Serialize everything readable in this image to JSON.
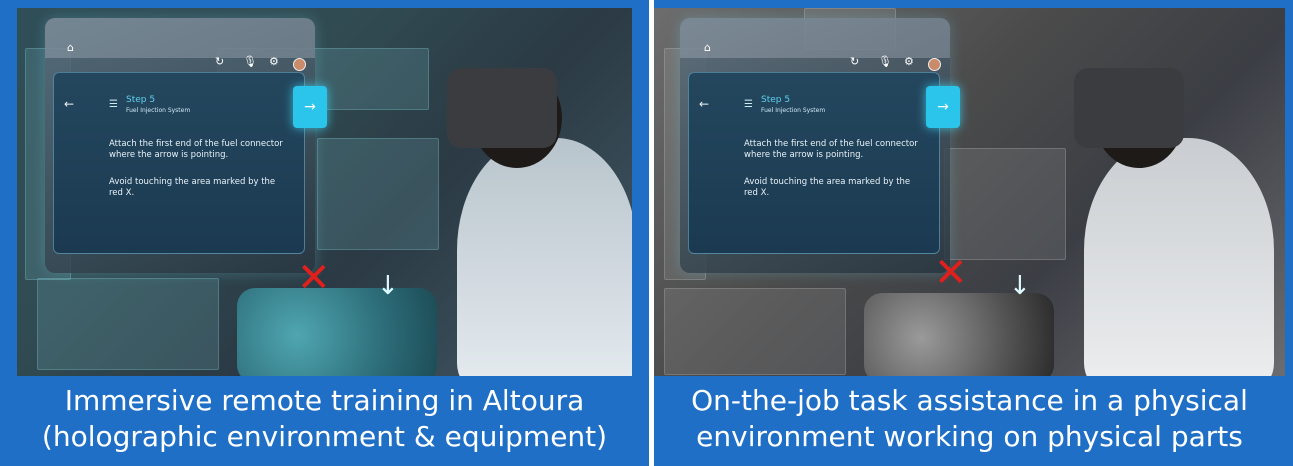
{
  "panels": [
    {
      "caption_line1": "Immersive remote training in Altoura",
      "caption_line2": "(holographic environment & equipment)",
      "hologram": {
        "step_title": "Step 5",
        "step_subtitle": "Fuel Injection System",
        "instruction_1": "Attach the first end of the fuel connector where the arrow is pointing.",
        "instruction_2": "Avoid touching the area marked by the red X."
      },
      "icons": [
        "home-icon",
        "refresh-icon",
        "mic-icon",
        "settings-icon",
        "avatar",
        "back-arrow-icon",
        "list-icon",
        "next-arrow-icon",
        "red-x-marker",
        "down-arrow-marker"
      ]
    },
    {
      "caption_line1": "On-the-job task assistance in a physical",
      "caption_line2": "environment working on physical parts",
      "hologram": {
        "step_title": "Step 5",
        "step_subtitle": "Fuel Injection System",
        "instruction_1": "Attach the first end of the fuel connector where the arrow is pointing.",
        "instruction_2": "Avoid touching the area marked by the red X."
      },
      "icons": [
        "home-icon",
        "refresh-icon",
        "mic-icon",
        "settings-icon",
        "avatar",
        "back-arrow-icon",
        "list-icon",
        "next-arrow-icon",
        "red-x-marker",
        "down-arrow-marker"
      ]
    }
  ],
  "colors": {
    "panel_blue": "#1f6fc6",
    "next_button": "#2bc4ea",
    "step_title": "#5fd0f2",
    "red_x": "#e0201c"
  }
}
